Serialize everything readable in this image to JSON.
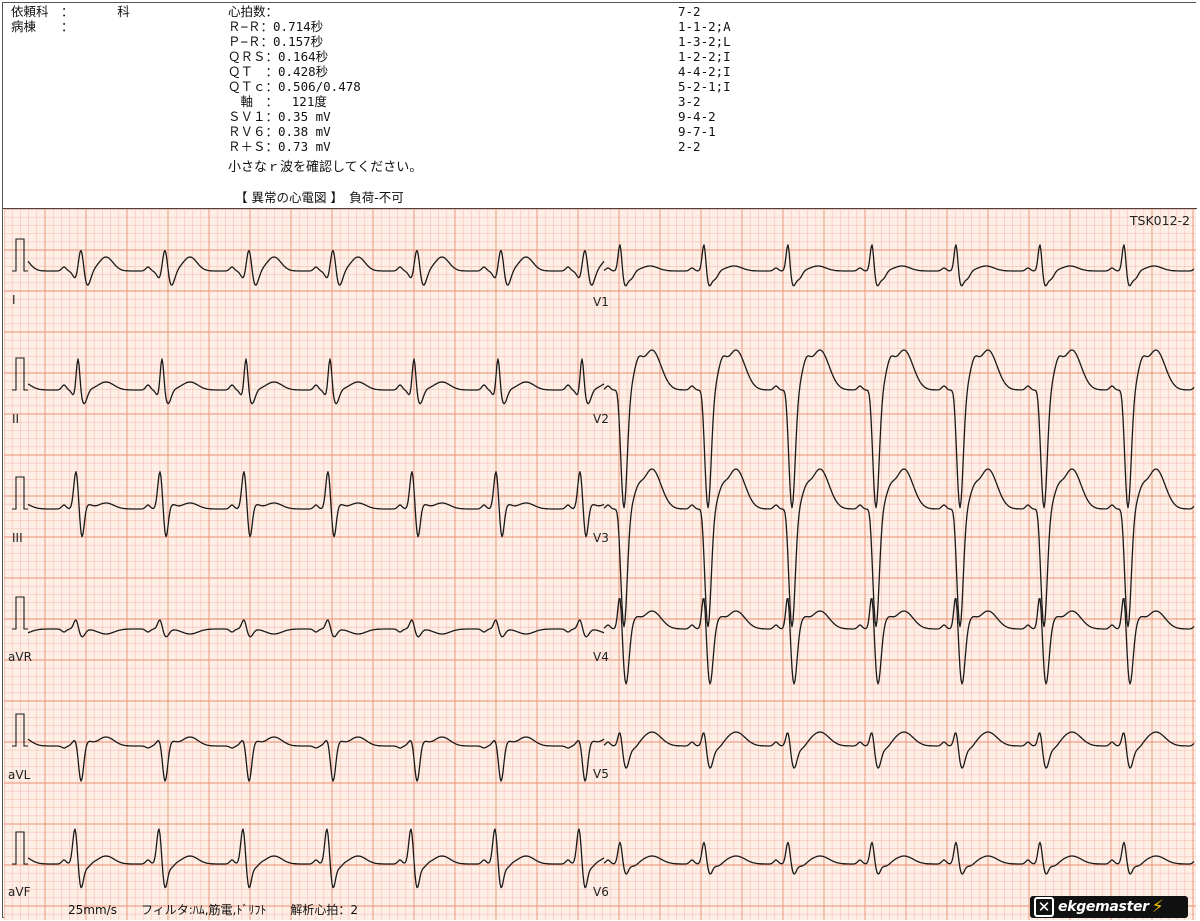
{
  "header": {
    "dept": "依頼科　：　　　　科",
    "ward": "病棟　　：",
    "heart_rate": "心拍数：",
    "measurements": [
      "Ｒ−Ｒ：0.714秒",
      "Ｐ−Ｒ：0.157秒",
      "ＱＲＳ：0.164秒",
      "ＱＴ　：0.428秒",
      "ＱＴｃ：0.506/0.478",
      "　軸　：　 121度",
      "ＳＶ１：0.35 mV",
      "ＲＶ６：0.38 mV",
      "Ｒ＋Ｓ：0.73 mV"
    ],
    "codes": [
      "7-2",
      "1-1-2;A",
      "1-3-2;L",
      "1-2-2;I",
      "4-4-2;I",
      "5-2-1;I",
      "3-2",
      "9-4-2",
      "9-7-1",
      "2-2"
    ],
    "note": "小さなｒ波を確認してください。",
    "status": "【 異常の心電図 】　負荷-不可"
  },
  "ecg": {
    "record_id": "TSK012-2",
    "leads_left": [
      "I",
      "II",
      "III",
      "aVR",
      "aVL",
      "aVF"
    ],
    "leads_right": [
      "V1",
      "V2",
      "V3",
      "V4",
      "V5",
      "V6"
    ],
    "footer": "25mm/s　　フィルタ:ﾊﾑ,筋電,ﾄﾞﾘﾌﾄ　　解析心拍：2",
    "colors": {
      "grid_minor": "#f6c4b4",
      "grid_major": "#ec8f74",
      "paper": "#fdeee6",
      "trace": "#1a1a1a"
    }
  },
  "logo": {
    "text": "ekgemaster"
  }
}
